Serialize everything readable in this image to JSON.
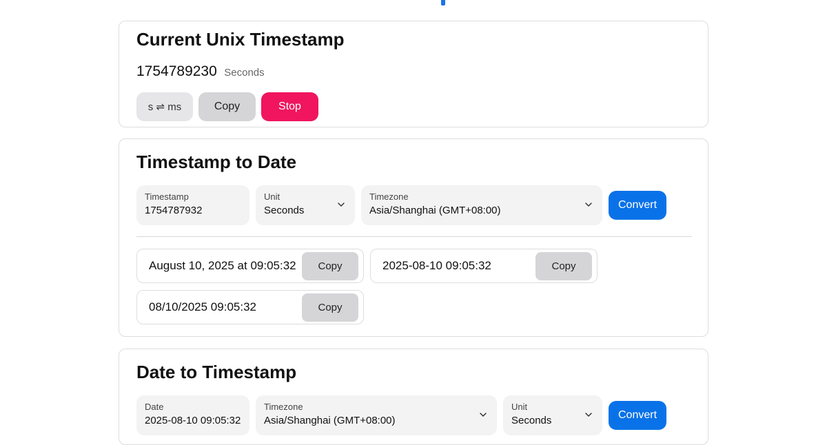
{
  "current": {
    "title": "Current Unix Timestamp",
    "timestamp": "1754789230",
    "unit": "Seconds",
    "toggle_label": "s ⇌ ms",
    "copy_label": "Copy",
    "stop_label": "Stop"
  },
  "ts_to_date": {
    "title": "Timestamp to Date",
    "timestamp_label": "Timestamp",
    "timestamp_value": "1754787932",
    "unit_label": "Unit",
    "unit_value": "Seconds",
    "timezone_label": "Timezone",
    "timezone_value": "Asia/Shanghai (GMT+08:00)",
    "convert_label": "Convert",
    "results": [
      {
        "text": "August 10, 2025 at 09:05:32",
        "copy_label": "Copy"
      },
      {
        "text": "2025-08-10 09:05:32",
        "copy_label": "Copy"
      },
      {
        "text": "08/10/2025 09:05:32",
        "copy_label": "Copy"
      }
    ]
  },
  "date_to_ts": {
    "title": "Date to Timestamp",
    "date_label": "Date",
    "date_value": "2025-08-10 09:05:32",
    "timezone_label": "Timezone",
    "timezone_value": "Asia/Shanghai (GMT+08:00)",
    "unit_label": "Unit",
    "unit_value": "Seconds",
    "convert_label": "Convert"
  },
  "colors": {
    "accent_blue": "#0a72e8",
    "stop_red": "#f0155e",
    "button_gray": "#d5d5d8",
    "field_bg": "#f3f3f4"
  },
  "icons": {
    "dropdown": "chevron-down-icon"
  }
}
